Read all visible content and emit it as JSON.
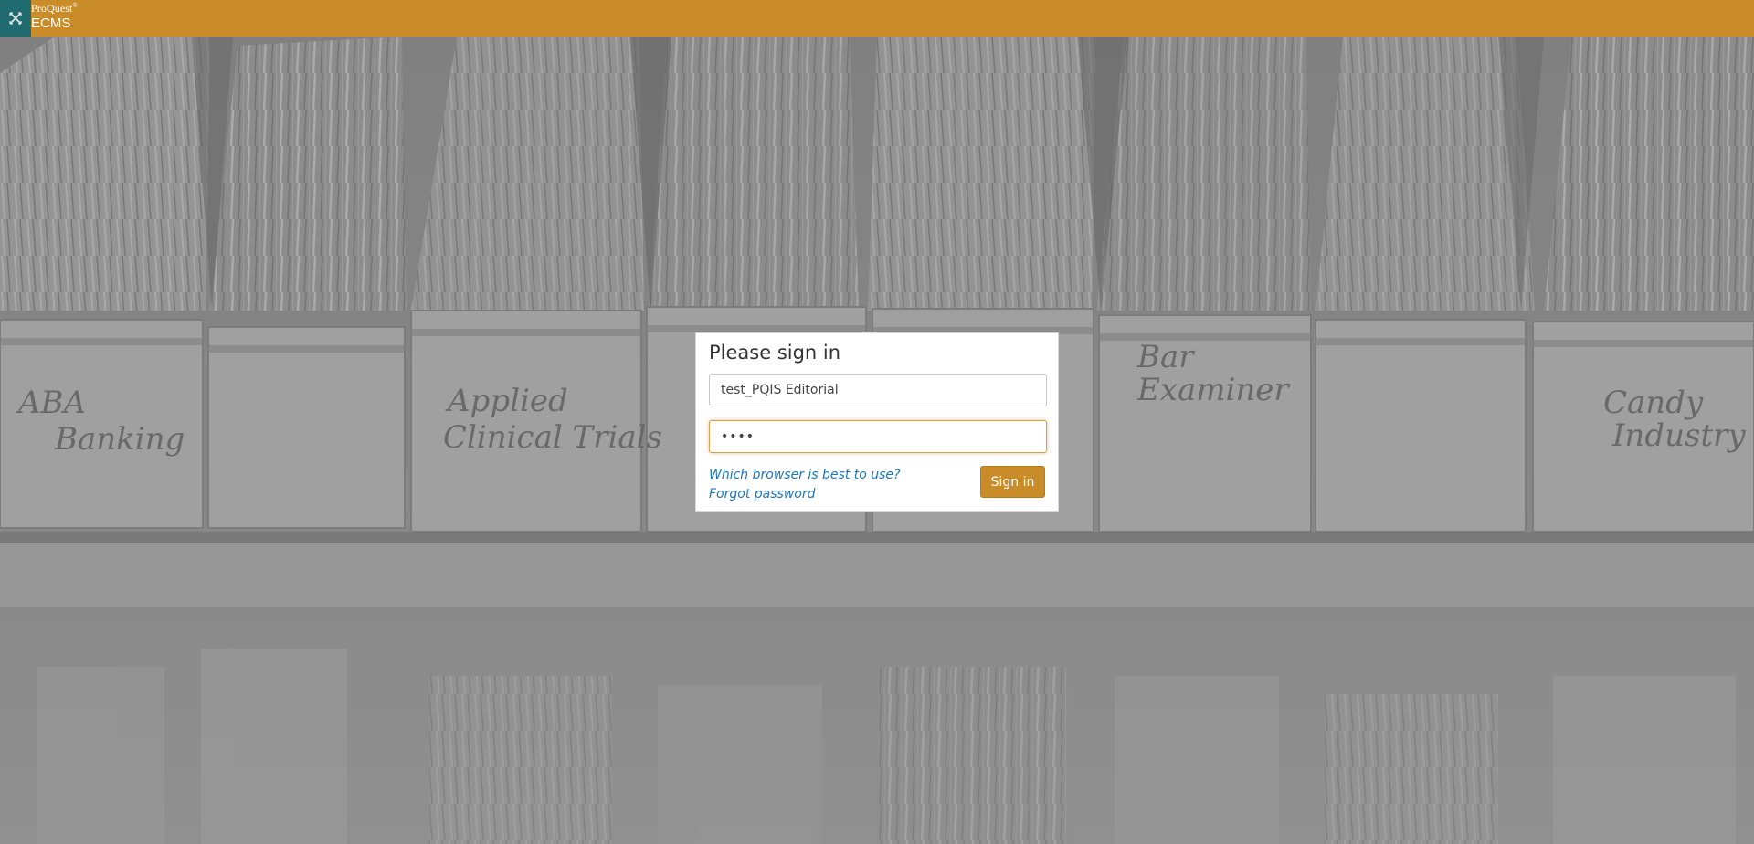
{
  "header": {
    "menu_icon": "close-x-icon",
    "brand_name": "ProQuest",
    "brand_reg": "®",
    "product_name": "ECMS",
    "bar_color": "#c98c28",
    "tile_color": "#1f6b6f"
  },
  "background": {
    "box_labels": [
      "ABA Banking",
      "Applied Clinical Trials",
      "Bar Examiner",
      "Candy Industry"
    ]
  },
  "signin": {
    "title": "Please sign in",
    "username_value": "test_PQIS Editorial",
    "password_value": "••••",
    "link_browser": "Which browser is best to use?",
    "link_forgot": "Forgot password",
    "button_label": "Sign in",
    "accent_color": "#c98c28",
    "link_color": "#1f76b7"
  }
}
